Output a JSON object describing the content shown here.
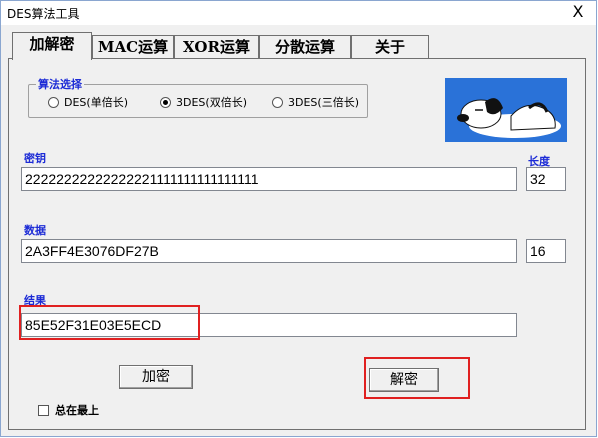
{
  "window": {
    "title": "DES算法工具",
    "close_glyph": "X"
  },
  "tabs": [
    {
      "label": "加解密"
    },
    {
      "label": "MAC运算"
    },
    {
      "label": "XOR运算"
    },
    {
      "label": "分散运算"
    },
    {
      "label": "关于"
    }
  ],
  "algorithm": {
    "legend": "算法选择",
    "options": [
      {
        "label": "DES(单倍长)",
        "selected": false
      },
      {
        "label": "3DES(双倍长)",
        "selected": true
      },
      {
        "label": "3DES(三倍长)",
        "selected": false
      }
    ]
  },
  "key": {
    "label": "密钥",
    "value": "22222222222222221111111111111111"
  },
  "length": {
    "label": "长度",
    "key_length": "32",
    "data_length": "16"
  },
  "data": {
    "label": "数据",
    "value": "2A3FF4E3076DF27B"
  },
  "result": {
    "label": "结果",
    "value": "85E52F31E03E5ECD"
  },
  "buttons": {
    "encrypt": "加密",
    "decrypt": "解密"
  },
  "always_on_top": {
    "label": "总在最上",
    "checked": false
  },
  "colors": {
    "label_blue": "#1c2bd6",
    "highlight_red": "#e02020",
    "image_bg": "#2a72d8"
  }
}
